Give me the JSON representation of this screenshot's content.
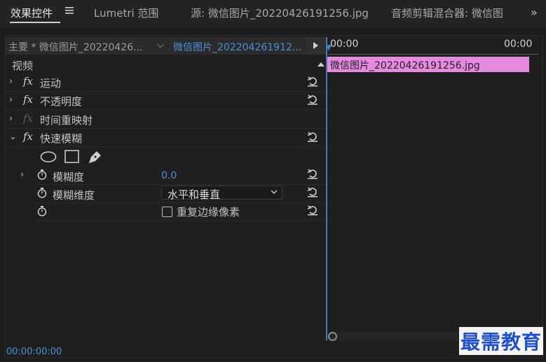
{
  "tabs": [
    {
      "label": "效果控件",
      "active": true
    },
    {
      "label": "Lumetri 范围",
      "active": false
    },
    {
      "label": "源: 微信图片_20220426191256.jpg",
      "active": false
    },
    {
      "label": "音频剪辑混合器: 微信图",
      "active": false
    }
  ],
  "source_header": {
    "master": "主要 * 微信图片_20220426...",
    "clip": "微信图片_202204261912..."
  },
  "section": {
    "label": "视频"
  },
  "effects": [
    {
      "label": "运动",
      "fx_enabled": true
    },
    {
      "label": "不透明度",
      "fx_enabled": true
    },
    {
      "label": "时间重映射",
      "fx_enabled": false
    },
    {
      "label": "快速模糊",
      "fx_enabled": true
    }
  ],
  "properties": {
    "blurriness": {
      "label": "模糊度",
      "value": "0.0"
    },
    "blur_dimensions": {
      "label": "模糊维度",
      "value": "水平和垂直"
    },
    "repeat_edge": {
      "label": "重复边缘像素",
      "checked": false
    }
  },
  "timeline": {
    "start_tc": "00:00",
    "end_tc": "00:00",
    "clip_label": "微信图片_20220426191256.jpg",
    "clip_color": "#e68ae0"
  },
  "footer": {
    "timecode": "00:00:00:00"
  },
  "watermark": "最需教育",
  "colors": {
    "accent": "#4a90d9",
    "clip": "#e68ae0"
  }
}
